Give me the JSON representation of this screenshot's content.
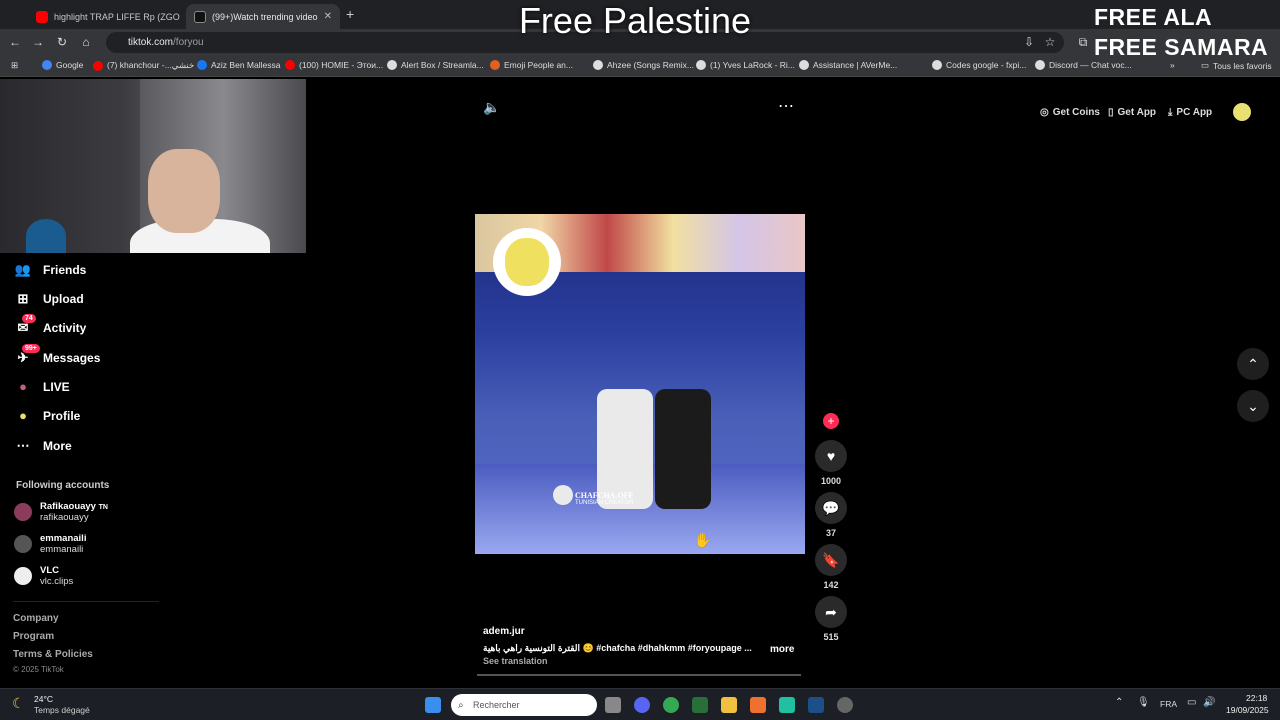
{
  "overlay": {
    "title": "Free Palestine",
    "free1": "FREE ALA",
    "free2": "FREE SAMARA"
  },
  "browser": {
    "tabs": [
      {
        "label": "highlight TRAP LIFFE Rp (ZGO",
        "icon_color": "#ff0000"
      },
      {
        "label": "(99+)Watch trending video",
        "icon_color": "#ffffff"
      }
    ],
    "url_host": "tiktok.com",
    "url_path": "/foryou",
    "bookmarks": [
      {
        "label": "Google",
        "color": "#4285f4"
      },
      {
        "label": "(7) khanchour -...خنشي",
        "color": "#ff0000"
      },
      {
        "label": "Aziz Ben Mallessa",
        "color": "#1877f2"
      },
      {
        "label": "(100) HOMIE - Этои...",
        "color": "#ff0000"
      },
      {
        "label": "Alert Box / Streamla...",
        "color": "#ffffff"
      },
      {
        "label": "Emoji People an...",
        "color": "#e06020"
      },
      {
        "label": "Ahzee (Songs Remix...",
        "color": "#ffffff"
      },
      {
        "label": "(1) Yves LaRock - Ri...",
        "color": "#ffffff"
      },
      {
        "label": "Assistance | AVerMe...",
        "color": "#ffffff"
      },
      {
        "label": "Codes google - fxpi...",
        "color": "#ffffff"
      },
      {
        "label": "Discord — Chat voc...",
        "color": "#ffffff"
      }
    ],
    "all_bookmarks": "Tous les favoris"
  },
  "sidebar": {
    "nav": [
      {
        "label": "Friends",
        "icon": "friends-icon",
        "glyph": "👥"
      },
      {
        "label": "Upload",
        "icon": "upload-icon",
        "glyph": "⊞"
      },
      {
        "label": "Activity",
        "icon": "activity-icon",
        "glyph": "✉",
        "badge": "74"
      },
      {
        "label": "Messages",
        "icon": "messages-icon",
        "glyph": "✈",
        "badge": "99+"
      },
      {
        "label": "LIVE",
        "icon": "live-icon",
        "glyph": "●"
      },
      {
        "label": "Profile",
        "icon": "profile-icon",
        "glyph": "●"
      },
      {
        "label": "More",
        "icon": "more-icon",
        "glyph": "⋯"
      }
    ],
    "following_header": "Following accounts",
    "following": [
      {
        "name": "Rafikaouayy",
        "flag": "TN",
        "handle": "rafikaouayy"
      },
      {
        "name": "emmanaili",
        "flag": "",
        "handle": "emmanaili"
      },
      {
        "name": "VLC",
        "flag": "",
        "handle": "vlc.clips"
      }
    ],
    "footer": [
      "Company",
      "Program",
      "Terms & Policies"
    ],
    "copyright": "© 2025 TikTok"
  },
  "header_actions": {
    "coins": "Get Coins",
    "app": "Get App",
    "pc": "PC App"
  },
  "video": {
    "overlay_name": "CHAFCHA.OFF",
    "overlay_sub": "TUNISIAN CREATOR",
    "author": "adem.jur",
    "caption_ar": "القترة التونسية راهي باهية 😊",
    "hashtags": "#chafcha  #dhahkmm  #foryoupage ...",
    "more": "more",
    "see_translation": "See translation"
  },
  "actions": {
    "likes": "1000",
    "comments": "37",
    "saves": "142",
    "shares": "515"
  },
  "taskbar": {
    "weather_temp": "24°C",
    "weather_desc": "Temps dégagé",
    "search_placeholder": "Rechercher",
    "lang": "FRA",
    "time": "22:18",
    "date": "19/09/2025"
  }
}
